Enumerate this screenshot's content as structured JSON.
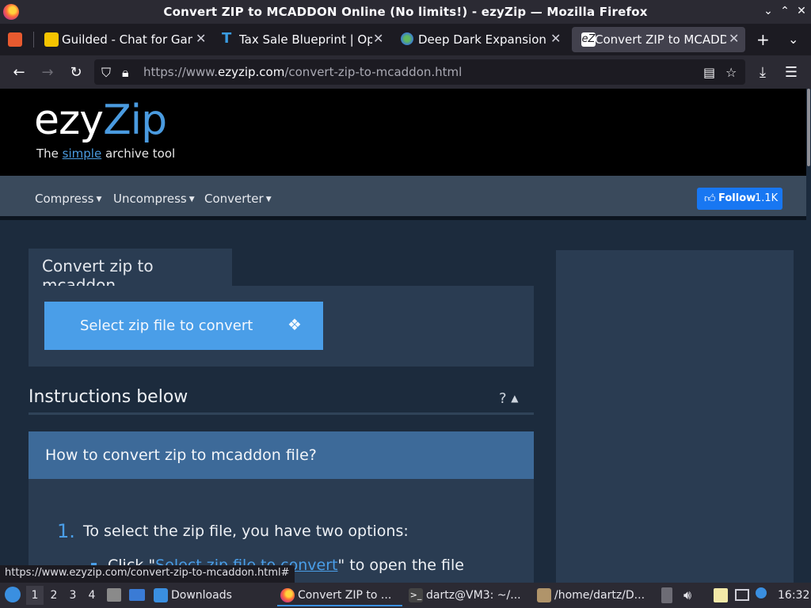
{
  "window": {
    "title": "Convert ZIP to MCADDON Online (No limits!) - ezyZip — Mozilla Firefox",
    "controls": {
      "minimize": "⌄",
      "maximize": "⌃",
      "close": "✕"
    }
  },
  "tabs": [
    {
      "label": "Guilded - Chat for Gaming",
      "icon": "guilded-icon"
    },
    {
      "label": "Tax Sale Blueprint | Opt-In",
      "icon": "t-icon"
    },
    {
      "label": "Deep Dark Expansion Mod",
      "icon": "globe-icon"
    },
    {
      "label": "Convert ZIP to MCADDON",
      "icon": "ezyzip-icon",
      "active": true
    }
  ],
  "tab_actions": {
    "new_tab": "+",
    "list_tabs": "⌄"
  },
  "navbar": {
    "url_prefix": "https://www.",
    "url_domain": "ezyzip.com",
    "url_path": "/convert-zip-to-mcaddon.html"
  },
  "site": {
    "logo_ezy": "ezy",
    "logo_zip": "Zip",
    "tagline_pre": "The ",
    "tagline_simple": "simple",
    "tagline_post": " archive tool",
    "nav": [
      {
        "label": "Compress"
      },
      {
        "label": "Uncompress"
      },
      {
        "label": "Converter"
      }
    ],
    "follow_label": "Follow",
    "follow_count": "1.1K"
  },
  "converter": {
    "tab_title": "Convert zip to mcaddon",
    "select_button": "Select zip file to convert"
  },
  "instructions": {
    "heading": "Instructions below",
    "help": "?",
    "howto_title": "How to convert zip to mcaddon file?",
    "step1_num": "1.",
    "step1_text": "To select the zip file, you have two options:",
    "sub_pre": "Click \"",
    "sub_link": "Select zip file to convert",
    "sub_post": "\" to open the file"
  },
  "status_url": "https://www.ezyzip.com/convert-zip-to-mcaddon.html#",
  "taskbar": {
    "workspaces": [
      "1",
      "2",
      "3",
      "4"
    ],
    "downloads_label": "Downloads",
    "windows": [
      {
        "label": "Convert ZIP to ...",
        "active": true
      },
      {
        "label": "dartz@VM3: ~/..."
      },
      {
        "label": "/home/dartz/D..."
      }
    ],
    "clock": "16:32"
  }
}
